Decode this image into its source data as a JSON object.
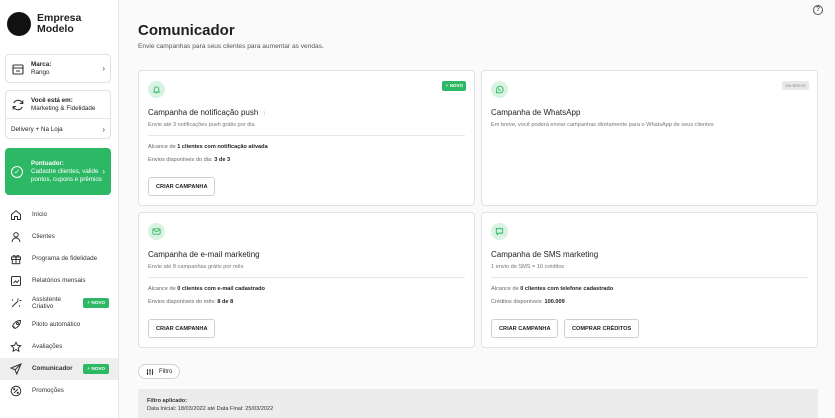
{
  "brand": {
    "name": "Empresa Modelo"
  },
  "marca": {
    "label": "Marca:",
    "value": "Rango"
  },
  "location": {
    "label": "Você está em:",
    "value": "Marketing & Fidelidade",
    "channel": "Delivery + Na Loja"
  },
  "promo": {
    "title": "Pontuador:",
    "text": "Cadastre clientes, valide pontos, cupons e prêmios"
  },
  "menu": [
    {
      "label": "Início",
      "icon": "home-icon"
    },
    {
      "label": "Clientes",
      "icon": "user-icon"
    },
    {
      "label": "Programa de fidelidade",
      "icon": "gift-icon"
    },
    {
      "label": "Relatórios mensais",
      "icon": "report-icon"
    },
    {
      "label": "Assistente Criativo",
      "icon": "magic-wand-icon",
      "badge": "NOVO"
    },
    {
      "label": "Piloto automático",
      "icon": "rocket-icon"
    },
    {
      "label": "Avaliações",
      "icon": "star-icon"
    },
    {
      "label": "Comunicador",
      "icon": "send-icon",
      "badge": "NOVO",
      "active": true
    },
    {
      "label": "Promoções",
      "icon": "percent-icon"
    }
  ],
  "header": {
    "title": "Comunicador",
    "subtitle": "Envie campanhas para seus clientes para aumentar as vendas."
  },
  "campaigns": {
    "push": {
      "badge": "NOVO",
      "title": "Campanha de notificação push",
      "info": "i",
      "desc": "Envie até 3 notificações push grátis por dia",
      "line1_pre": "Alcance de ",
      "line1_bold": "1 clientes com notificação ativada",
      "line2_pre": "Envios disponíveis do dia: ",
      "line2_bold": "3 de 3",
      "button": "CRIAR CAMPANHA"
    },
    "whatsapp": {
      "badge": "EM BREVE",
      "title": "Campanha de WhatsApp",
      "desc": "Em breve, você poderá enviar campanhas diretamente para o WhatsApp de seus clientes"
    },
    "email": {
      "title": "Campanha de e-mail marketing",
      "desc": "Envie até 8 campanhas grátis por mês",
      "line1_pre": "Alcance de ",
      "line1_bold": "0 clientes com e-mail cadastrado",
      "line2_pre": "Envios disponíveis do mês: ",
      "line2_bold": "8 de 8",
      "button": "CRIAR CAMPANHA"
    },
    "sms": {
      "title": "Campanha de SMS marketing",
      "desc": "1 envio de SMS = 10 créditos",
      "line1_pre": "Alcance de ",
      "line1_bold": "0 clientes com telefone cadastrado",
      "line2_pre": "Créditos disponíveis: ",
      "line2_bold": "100.009",
      "button": "CRIAR CAMPANHA",
      "button2": "COMPRAR CRÉDITOS"
    }
  },
  "filter": {
    "button": "Filtro",
    "applied_label": "Filtro aplicado:",
    "applied_value": "Data Inicial: 18/03/2022 até Data Final: 25/03/2022"
  },
  "help": "?",
  "colors": {
    "accent": "#2db865",
    "accent_light": "#d9f3e3"
  }
}
